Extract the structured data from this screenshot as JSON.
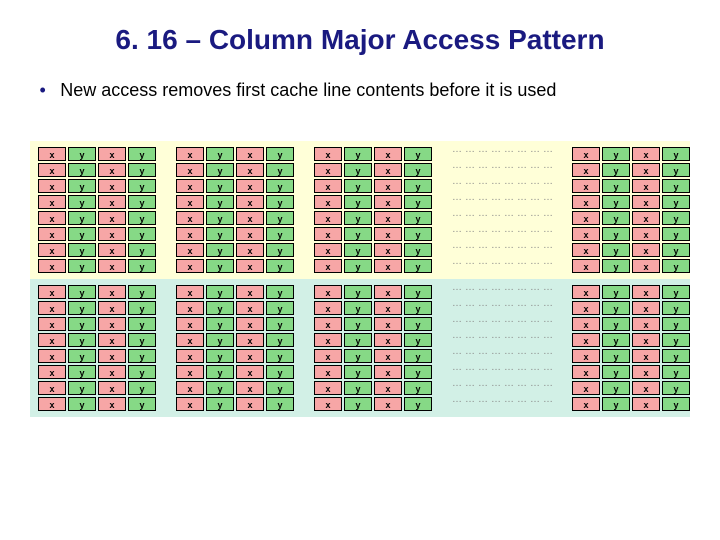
{
  "title": "6. 16 – Column Major Access Pattern",
  "bullet": "New access removes first cache line contents before it is used",
  "labels": {
    "x": "x",
    "y": "y"
  },
  "chart_data": {
    "type": "table",
    "title": "Column-major memory layout and cache lines",
    "bands": 2,
    "rows_per_band": 8,
    "sections_per_band": 4,
    "section_pattern": [
      "x",
      "y",
      "x",
      "y"
    ],
    "ellipsis_after_section": 3,
    "band_colors": [
      "#ffffd8",
      "#d2f0e6"
    ],
    "cell_colors": {
      "x": "#f7a6a6",
      "y": "#86d986"
    }
  }
}
